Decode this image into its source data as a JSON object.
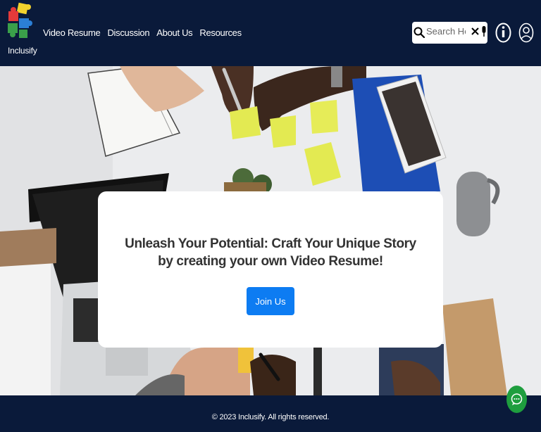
{
  "brand": {
    "name": "Inclusify",
    "logo_icon": "puzzle-pieces-logo"
  },
  "nav": {
    "links": [
      {
        "label": "Video Resume"
      },
      {
        "label": "Discussion"
      },
      {
        "label": "About Us"
      },
      {
        "label": "Resources"
      }
    ]
  },
  "search": {
    "placeholder": "Search Her",
    "value": "",
    "icons": [
      "search-icon",
      "clear-icon",
      "microphone-icon"
    ]
  },
  "header_icons": [
    "info-icon",
    "user-icon"
  ],
  "hero": {
    "headline": "Unleash Your Potential: Craft Your Unique Story by creating your own Video Resume!",
    "cta_label": "Join Us"
  },
  "footer": {
    "copyright": "© 2023 Inclusify. All rights reserved."
  },
  "chat_icon": "chat-bubble-icon",
  "colors": {
    "nav_bg": "#0a1a3a",
    "primary_button": "#0d7cf2",
    "chat_button": "#1e9e3e",
    "card_bg": "#ffffff"
  }
}
